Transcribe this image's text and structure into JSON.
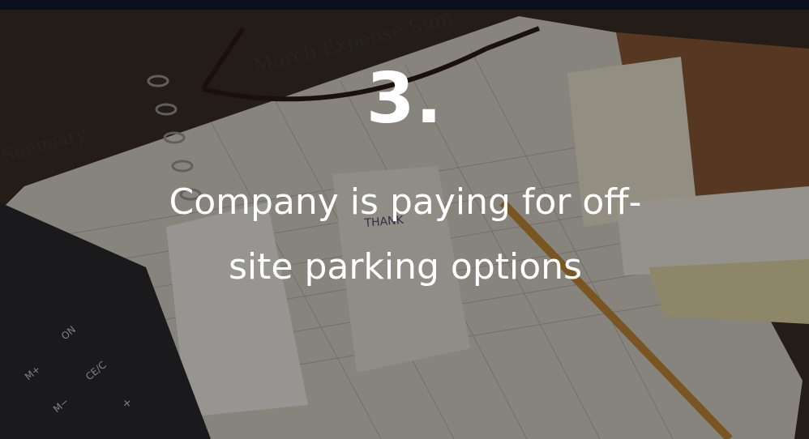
{
  "slide": {
    "number": "3.",
    "caption": "Company is paying for off-site parking options"
  },
  "background_text": {
    "sheet_title": "March Expense Sum",
    "summary_label": "Summary",
    "receipt_text": "THANK",
    "calc_key_on": "ON",
    "calc_key_m_plus": "M+",
    "calc_key_ce": "CE/C",
    "calc_key_m_minus": "M−",
    "calc_key_plus": "+"
  },
  "colors": {
    "text": "#ffffff",
    "topbar": "#0b1020",
    "overlay": "rgba(0,0,0,0.38)"
  }
}
